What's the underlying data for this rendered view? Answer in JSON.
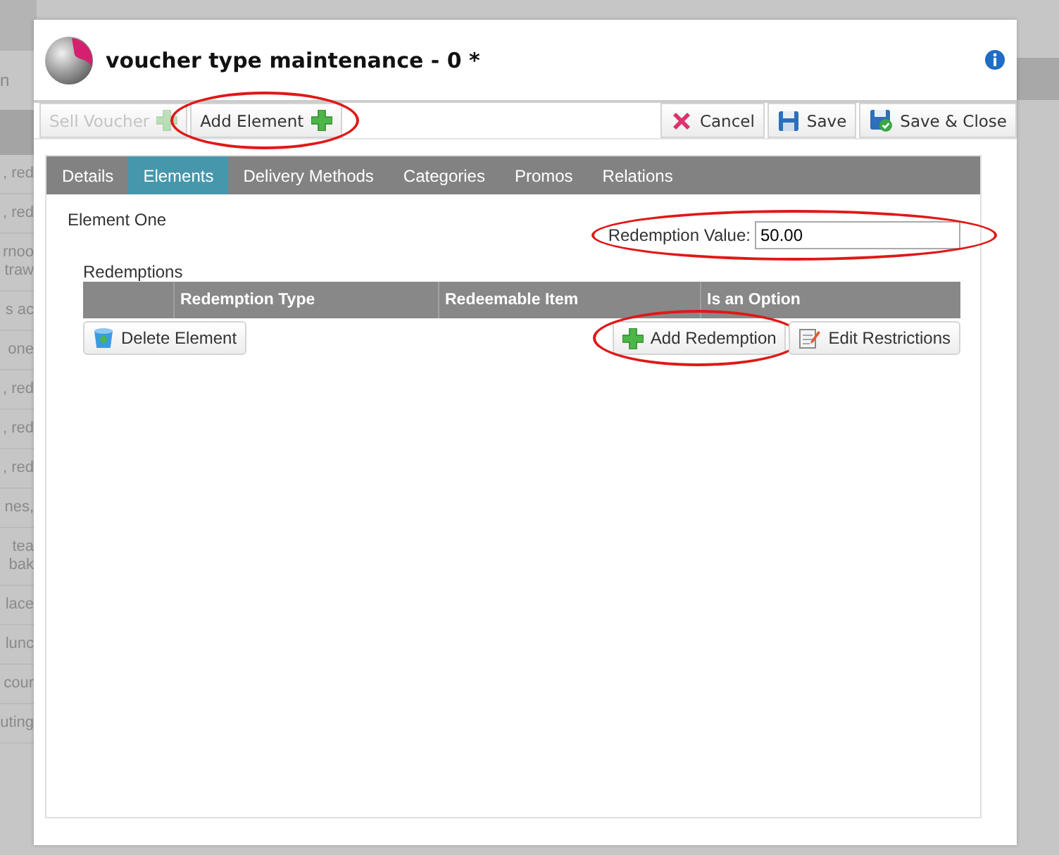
{
  "background": {
    "field_fragment": "n",
    "row_fragments": [
      ", red",
      ", red",
      "rnoo\ntraw",
      "s ac",
      "one",
      ", red",
      ", red",
      ", red",
      "nes,",
      "tea\nbak",
      "lace",
      "lunc",
      "cour",
      "uting"
    ]
  },
  "dialog": {
    "title": "voucher type maintenance - 0 *",
    "toolbar_left": [
      {
        "label": "Sell Voucher",
        "kind": "add",
        "disabled": true,
        "circled": false
      },
      {
        "label": "Add Element",
        "kind": "add",
        "disabled": false,
        "circled": true
      }
    ],
    "toolbar_right": [
      {
        "label": "Cancel",
        "kind": "cancel",
        "disabled": false,
        "circled": false
      },
      {
        "label": "Save",
        "kind": "save",
        "disabled": false,
        "circled": false
      },
      {
        "label": "Save & Close",
        "kind": "saveclose",
        "disabled": false,
        "circled": false
      }
    ],
    "tabs": [
      {
        "label": "Details",
        "selected": false
      },
      {
        "label": "Elements",
        "selected": true
      },
      {
        "label": "Delivery Methods",
        "selected": false
      },
      {
        "label": "Categories",
        "selected": false
      },
      {
        "label": "Promos",
        "selected": false
      },
      {
        "label": "Relations",
        "selected": false
      }
    ],
    "element_name": "Element One",
    "redemption_value": {
      "label": "Redemption Value:",
      "value": "50.00",
      "circled": true
    },
    "redemptions": {
      "title": "Redemptions",
      "columns": [
        "Redemption Type",
        "Redeemable Item",
        "Is an Option"
      ]
    },
    "actions_left": [
      {
        "label": "Delete Element",
        "kind": "delete",
        "disabled": false,
        "circled": false
      }
    ],
    "actions_right": [
      {
        "label": "Add Redemption",
        "kind": "add",
        "disabled": false,
        "circled": true
      },
      {
        "label": "Edit Restrictions",
        "kind": "edit",
        "disabled": false,
        "circled": false
      }
    ]
  }
}
